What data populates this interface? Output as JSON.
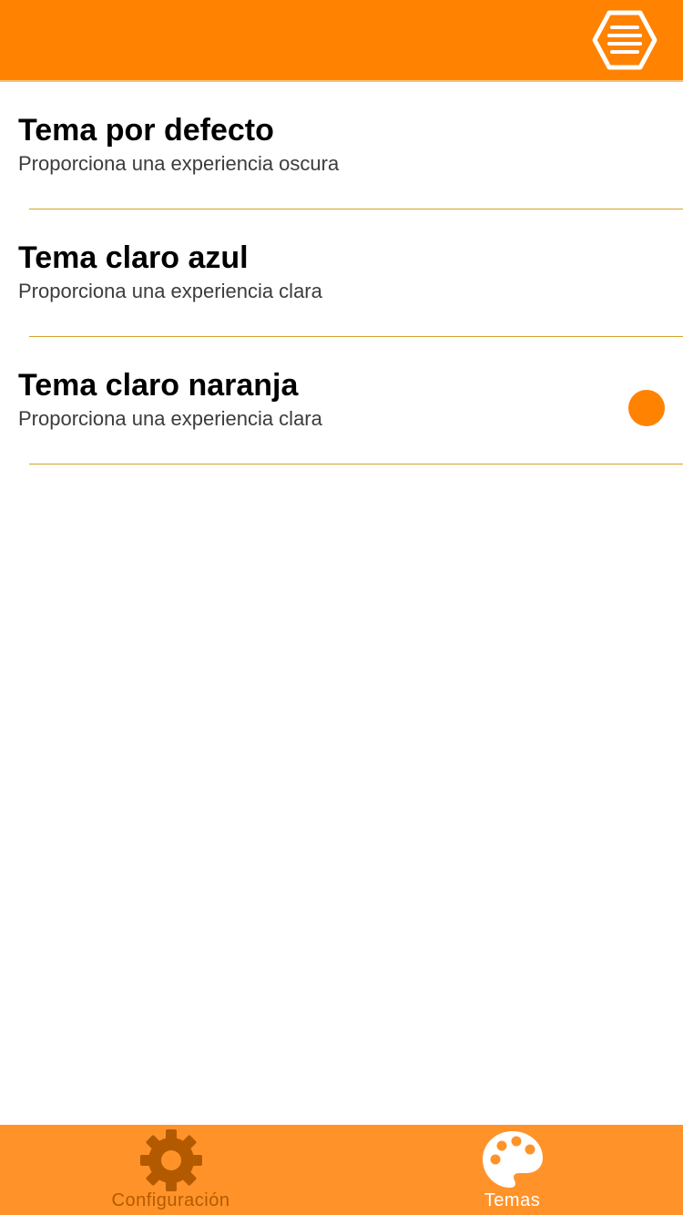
{
  "header": {
    "logo_icon": "hexagon-menu-icon",
    "background": "#FF8200"
  },
  "themes": [
    {
      "title": "Tema por defecto",
      "description": "Proporciona una experiencia oscura",
      "selected": false
    },
    {
      "title": "Tema claro azul",
      "description": "Proporciona una experiencia clara",
      "selected": false
    },
    {
      "title": "Tema claro naranja",
      "description": "Proporciona una experiencia clara",
      "selected": true
    }
  ],
  "tabbar": {
    "background": "#FF932A",
    "tabs": [
      {
        "label": "Configuración",
        "icon": "gear-icon",
        "active": false,
        "color": "#B35A00"
      },
      {
        "label": "Temas",
        "icon": "palette-icon",
        "active": true,
        "color": "#FFFFFF"
      }
    ]
  },
  "colors": {
    "accent": "#FF8200",
    "divider": "#D3A22A"
  }
}
